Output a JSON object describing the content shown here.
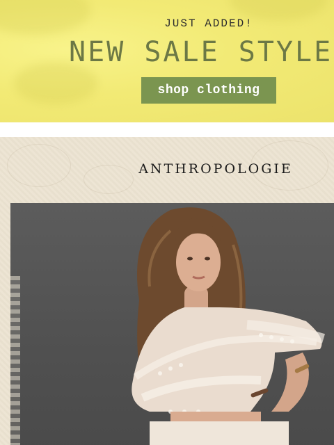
{
  "banner": {
    "kicker": "JUST ADDED!",
    "headline": "NEW SALE STYLE",
    "cta_label": "shop clothing",
    "colors": {
      "background": "#f2ea75",
      "headline": "#6c7845",
      "button": "#7b9550"
    }
  },
  "brand": {
    "name": "ANTHROPOLOGIE"
  },
  "hero": {
    "image": "model-in-cream-lace-blouse-photo"
  }
}
